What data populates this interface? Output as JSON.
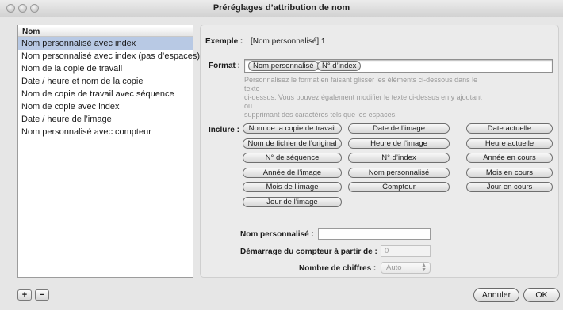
{
  "window": {
    "title": "Préréglages d’attribution de nom"
  },
  "list": {
    "header": "Nom",
    "items": [
      {
        "label": "Nom personnalisé avec index"
      },
      {
        "label": "Nom personnalisé avec index (pas d’espaces)"
      },
      {
        "label": "Nom de la copie de travail"
      },
      {
        "label": "Date / heure et nom de la copie"
      },
      {
        "label": "Nom de copie de travail avec séquence"
      },
      {
        "label": "Nom de copie avec index"
      },
      {
        "label": "Date / heure de l’image"
      },
      {
        "label": "Nom personnalisé avec compteur"
      }
    ],
    "selected_index": 0
  },
  "example": {
    "label": "Exemple :",
    "value": "[Nom personnalisé] 1"
  },
  "format": {
    "label": "Format :",
    "tokens": [
      "Nom personnalisé",
      "N° d’index"
    ],
    "hint_lines": [
      "Personnalisez le format en faisant glisser les éléments ci-dessous dans le texte",
      "ci-dessus. Vous pouvez également modifier le texte ci-dessus en y ajoutant ou",
      "supprimant des caractères tels que les espaces."
    ]
  },
  "include": {
    "label": "Inclure :",
    "chips": [
      [
        "Nom de la copie de travail",
        "Date de l’image",
        "Date actuelle"
      ],
      [
        "Nom de fichier de l’original",
        "Heure de l’image",
        "Heure actuelle"
      ],
      [
        "N° de séquence",
        "N° d’index",
        "Année en cours"
      ],
      [
        "Année de l’image",
        "Nom personnalisé",
        "Mois en cours"
      ],
      [
        "Mois de l’image",
        "Compteur",
        "Jour en cours"
      ],
      [
        "Jour de l’image"
      ]
    ]
  },
  "fields": {
    "custom_name_label": "Nom personnalisé :",
    "custom_name_value": "",
    "counter_start_label": "Démarrage du compteur à partir de :",
    "counter_start_value": "0",
    "digits_label": "Nombre de chiffres :",
    "digits_value": "Auto"
  },
  "buttons": {
    "add": "+",
    "remove": "−",
    "cancel": "Annuler",
    "ok": "OK"
  }
}
